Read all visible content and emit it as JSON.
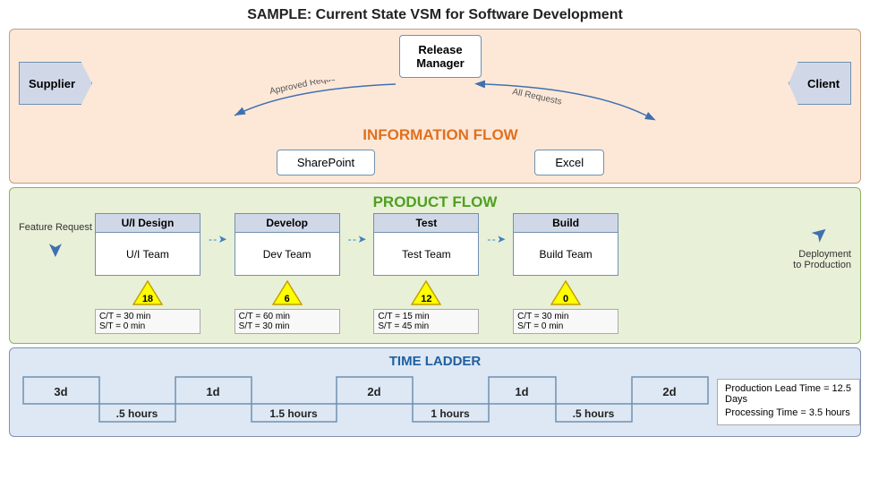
{
  "title": "SAMPLE: Current State VSM for Software Development",
  "infoFlow": {
    "label": "INFORMATION FLOW",
    "supplier": "Supplier",
    "client": "Client",
    "releaseManager": {
      "line1": "Release",
      "line2": "Manager"
    },
    "arrowLeft": "Approved Request",
    "arrowRight": "All Requests",
    "sharepoint": "SharePoint",
    "excel": "Excel"
  },
  "productFlow": {
    "label": "PRODUCT FLOW",
    "featureRequest": "Feature Request",
    "deploymentToProduction": "Deployment to Production",
    "steps": [
      {
        "name": "U/I Design",
        "team": "U/I Team",
        "wip": "18",
        "ct": "C/T = 30 min",
        "st": "S/T = 0 min"
      },
      {
        "name": "Develop",
        "team": "Dev Team",
        "wip": "6",
        "ct": "C/T = 60 min",
        "st": "S/T = 30 min"
      },
      {
        "name": "Test",
        "team": "Test Team",
        "wip": "12",
        "ct": "C/T = 15 min",
        "st": "S/T = 45 min"
      },
      {
        "name": "Build",
        "team": "Build Team",
        "wip": "0",
        "ct": "C/T = 30 min",
        "st": "S/T = 0 min"
      }
    ]
  },
  "timeLadder": {
    "label": "TIME LADDER",
    "segments": [
      {
        "type": "day",
        "value": "3d"
      },
      {
        "type": "hour",
        "value": ".5 hours"
      },
      {
        "type": "day",
        "value": "1d"
      },
      {
        "type": "hour",
        "value": "1.5 hours"
      },
      {
        "type": "day",
        "value": "2d"
      },
      {
        "type": "hour",
        "value": "1 hours"
      },
      {
        "type": "day",
        "value": "1d"
      },
      {
        "type": "hour",
        "value": ".5 hours"
      },
      {
        "type": "day",
        "value": "2d"
      }
    ],
    "legendLine1": "Production Lead Time = 12.5 Days",
    "legendLine2": "Processing Time = 3.5 hours"
  }
}
